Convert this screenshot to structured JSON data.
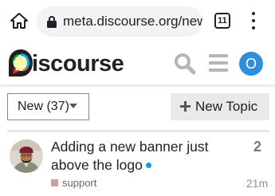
{
  "browser": {
    "url": "meta.discourse.org/new",
    "tab_count": "11"
  },
  "header": {
    "logo_text": "iscourse",
    "user_initial": "O",
    "avatar_color": "#2d8ede"
  },
  "controls": {
    "filter_label": "New (37)",
    "new_topic_label": "New Topic"
  },
  "topics": [
    {
      "title": "Adding a new banner just above the logo",
      "replies": "2",
      "category": "support",
      "category_color": "#c9a1a1",
      "age": "21m",
      "unread": true
    }
  ]
}
